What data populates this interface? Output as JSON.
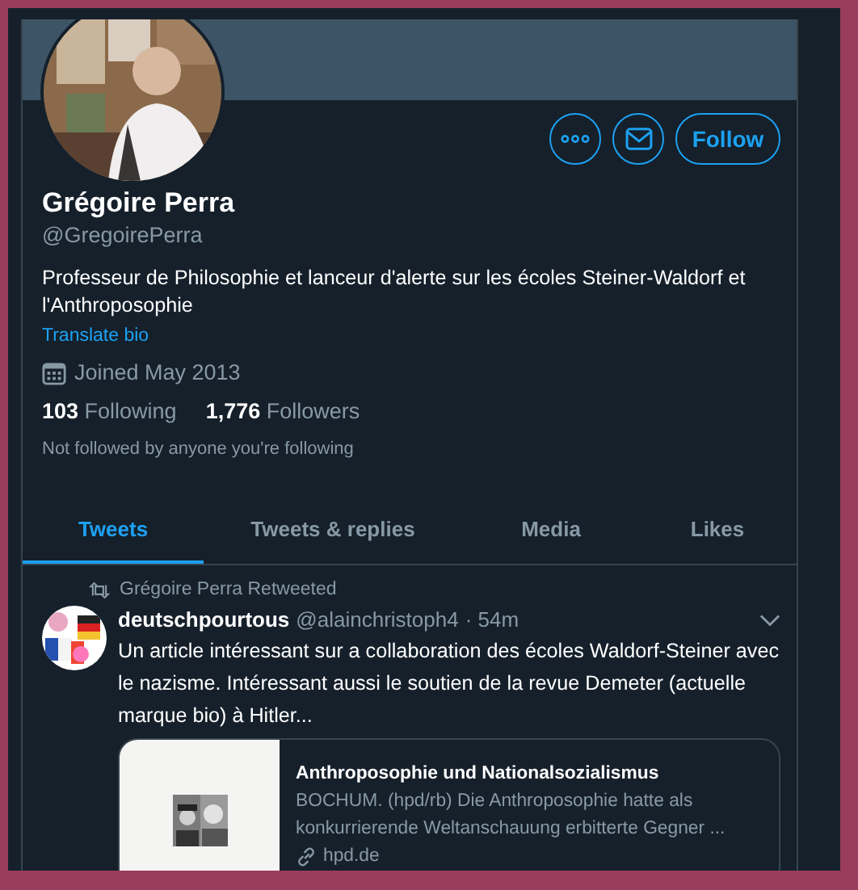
{
  "profile": {
    "name": "Grégoire Perra",
    "handle": "@GregoirePerra",
    "bio": "Professeur de Philosophie et lanceur d'alerte sur les écoles Steiner-Waldorf et l'Anthroposophie",
    "translate": "Translate bio",
    "joined": "Joined May 2013",
    "following_count": "103",
    "following_label": "Following",
    "followers_count": "1,776",
    "followers_label": "Followers",
    "followed_by": "Not followed by anyone you're following",
    "follow_button": "Follow"
  },
  "tabs": [
    {
      "label": "Tweets",
      "selected": true
    },
    {
      "label": "Tweets & replies",
      "selected": false
    },
    {
      "label": "Media",
      "selected": false
    },
    {
      "label": "Likes",
      "selected": false
    }
  ],
  "tweets": [
    {
      "retweeted_by": "Grégoire Perra Retweeted",
      "author": "deutschpourtous",
      "handle": "@alainchristoph4",
      "time": "· 54m",
      "text": "Un article intéressant sur a collaboration des écoles Waldorf-Steiner avec le nazisme. Intéressant aussi le soutien de la revue Demeter (actuelle marque bio) à Hitler...",
      "card": {
        "title": "Anthroposophie und Nationalsozialismus",
        "description": "BOCHUM. (hpd/rb) Die Anthroposophie hatte als konkurrierende Weltanschauung erbitterte Gegner ...",
        "domain": "hpd.de"
      }
    }
  ]
}
